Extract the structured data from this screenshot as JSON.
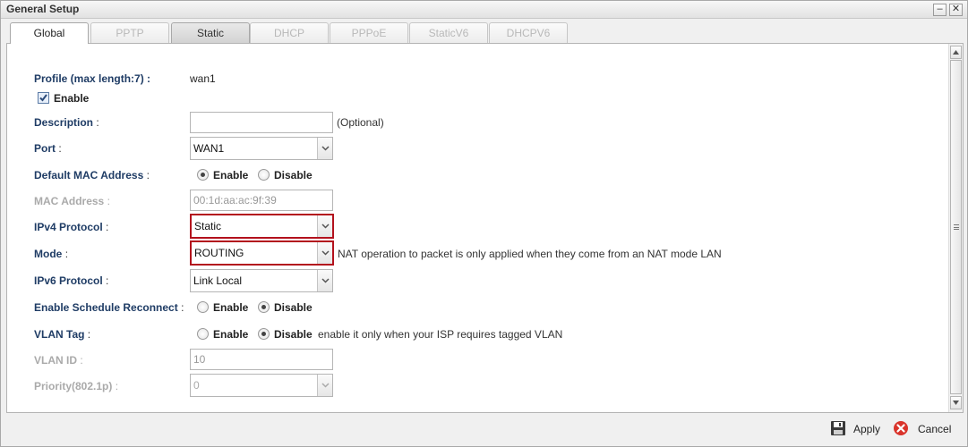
{
  "window": {
    "title": "General Setup",
    "minimize_label": "–",
    "close_label": "✕"
  },
  "tabs": [
    {
      "label": "Global",
      "state": "active"
    },
    {
      "label": "PPTP",
      "state": "disabled"
    },
    {
      "label": "Static",
      "state": "enabled"
    },
    {
      "label": "DHCP",
      "state": "disabled"
    },
    {
      "label": "PPPoE",
      "state": "disabled"
    },
    {
      "label": "StaticV6",
      "state": "disabled"
    },
    {
      "label": "DHCPV6",
      "state": "disabled"
    }
  ],
  "form": {
    "profile": {
      "label": "Profile (max length:7) :",
      "value": "wan1"
    },
    "enable": {
      "label": "Enable",
      "checked": true
    },
    "description": {
      "label": "Description",
      "value": "",
      "hint": "(Optional)"
    },
    "port": {
      "label": "Port",
      "value": "WAN1"
    },
    "default_mac": {
      "label": "Default MAC Address",
      "option_enable": "Enable",
      "option_disable": "Disable",
      "selected": "Enable"
    },
    "mac_address": {
      "label": "MAC Address",
      "value": "00:1d:aa:ac:9f:39"
    },
    "ipv4_protocol": {
      "label": "IPv4 Protocol",
      "value": "Static"
    },
    "mode": {
      "label": "Mode",
      "value": "ROUTING",
      "note": "NAT operation to packet is only applied when they come from an NAT mode LAN"
    },
    "ipv6_protocol": {
      "label": "IPv6 Protocol",
      "value": "Link Local"
    },
    "schedule_reconnect": {
      "label": "Enable Schedule Reconnect",
      "option_enable": "Enable",
      "option_disable": "Disable",
      "selected": "Disable"
    },
    "vlan_tag": {
      "label": "VLAN Tag",
      "option_enable": "Enable",
      "option_disable": "Disable",
      "selected": "Disable",
      "note": "enable it only when your ISP requires tagged VLAN"
    },
    "vlan_id": {
      "label": "VLAN ID",
      "value": "10"
    },
    "priority": {
      "label": "Priority(802.1p)",
      "value": "0"
    }
  },
  "footer": {
    "apply_label": "Apply",
    "cancel_label": "Cancel"
  },
  "colors": {
    "label_blue": "#1f3c65",
    "highlight_red": "#b3121d",
    "cancel_red": "#d9342b"
  }
}
